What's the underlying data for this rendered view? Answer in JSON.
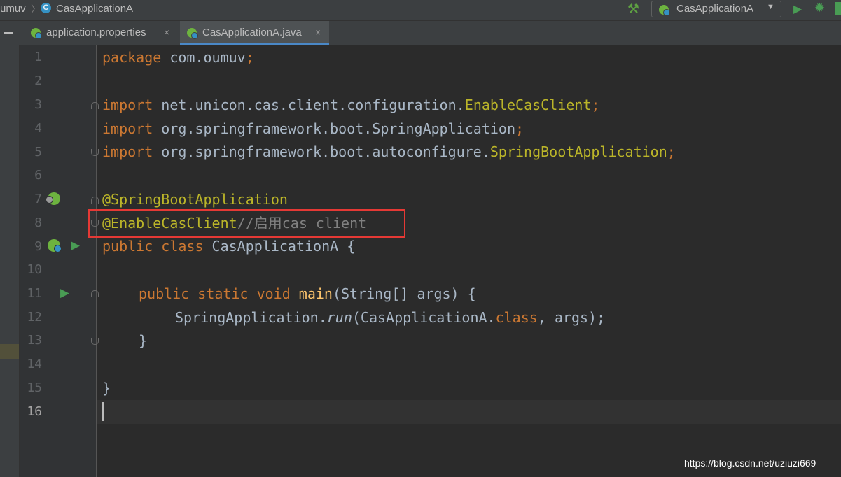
{
  "breadcrumb": {
    "project": "umuv",
    "class_icon": "C",
    "class_name": "CasApplicationA"
  },
  "toolbar": {
    "run_config_label": "CasApplicationA",
    "icons": [
      "hammer-icon",
      "run-icon",
      "debug-icon"
    ]
  },
  "tabs": [
    {
      "label": "application.properties",
      "close": "×",
      "active": false
    },
    {
      "label": "CasApplicationA.java",
      "close": "×",
      "active": true
    }
  ],
  "editor": {
    "line_numbers": [
      "1",
      "2",
      "3",
      "4",
      "5",
      "6",
      "7",
      "8",
      "9",
      "10",
      "11",
      "12",
      "13",
      "14",
      "15",
      "16"
    ],
    "current_line": "16",
    "lines": {
      "l1": {
        "kw": "package",
        "name": " com.oumuv",
        "semi": ";"
      },
      "l3": {
        "kw": "import",
        "pkg": " net.unicon.cas.client.configuration.",
        "cls": "EnableCasClient",
        "semi": ";"
      },
      "l4": {
        "kw": "import",
        "pkg": " org.springframework.boot.SpringApplication",
        "semi": ";"
      },
      "l5": {
        "kw": "import",
        "pkg": " org.springframework.boot.autoconfigure.",
        "cls": "SpringBootApplication",
        "semi": ";"
      },
      "l7": {
        "ann": "@SpringBootApplication"
      },
      "l8": {
        "ann": "@EnableCasClient",
        "comment": "//启用cas client"
      },
      "l9": {
        "kw": "public class",
        "name": " CasApplicationA {"
      },
      "l11": {
        "kw1": "public static void",
        "fn": "main",
        "params": "(String[] args) {"
      },
      "l12": {
        "pre": "SpringApplication.",
        "method": "run",
        "arg": "(CasApplicationA.",
        "kw": "class",
        "rest": ", args);"
      },
      "l13": {
        "text": "}"
      },
      "l15": {
        "text": "}"
      }
    }
  },
  "accent": {
    "spring_green": "#6db33f",
    "tab_underline": "#4a88c7",
    "highlight_box": "#e53935"
  },
  "watermark": "https://blog.csdn.net/uziuzi669"
}
